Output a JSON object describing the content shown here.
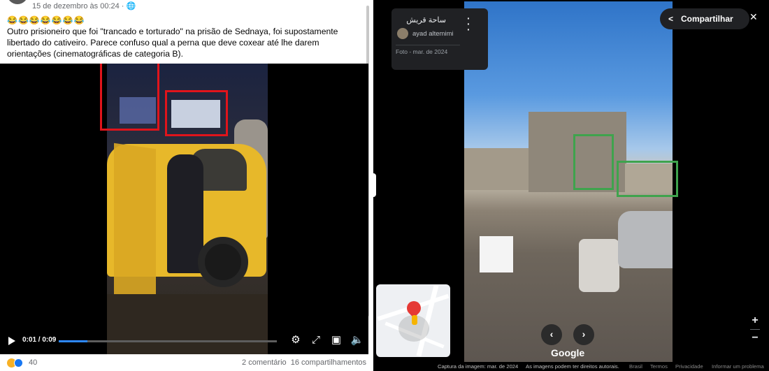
{
  "facebook_post": {
    "date": "15 de dezembro às 00:24 · ",
    "emojis": "😂😂😂😂😂😂😂",
    "text": "Outro prisioneiro que foi \"trancado e torturado\" na prisão de Sednaya, foi supostamente libertado do cativeiro. Parece confuso qual a perna que deve coxear até lhe darem orientações (cinematográficas de categoria B).",
    "video": {
      "time": "0:01 / 0:09",
      "progress_fraction": 0.13,
      "icons": [
        "play-icon",
        "settings-icon",
        "fullscreen-icon",
        "pip-icon",
        "volume-icon"
      ]
    },
    "reaction_count": "40",
    "comments": "2 comentário",
    "shares": "16 compartilhamentos"
  },
  "street_view": {
    "place_name": "ساحة قريش",
    "author": "ayad altemimi",
    "photo_date": "Foto - mar. de 2024",
    "share_label": "Compartilhar",
    "close_glyph": "✕",
    "brand": "Google",
    "zoom_in": "+",
    "zoom_out": "−",
    "prev_glyph": "‹",
    "next_glyph": "›",
    "footer": {
      "capture": "Captura da imagem: mar. de 2024",
      "rights": "As imagens podem ter direitos autorais.",
      "country": "Brasil",
      "terms": "Termos",
      "privacy": "Privacidade",
      "report": "Informar um problema"
    }
  }
}
